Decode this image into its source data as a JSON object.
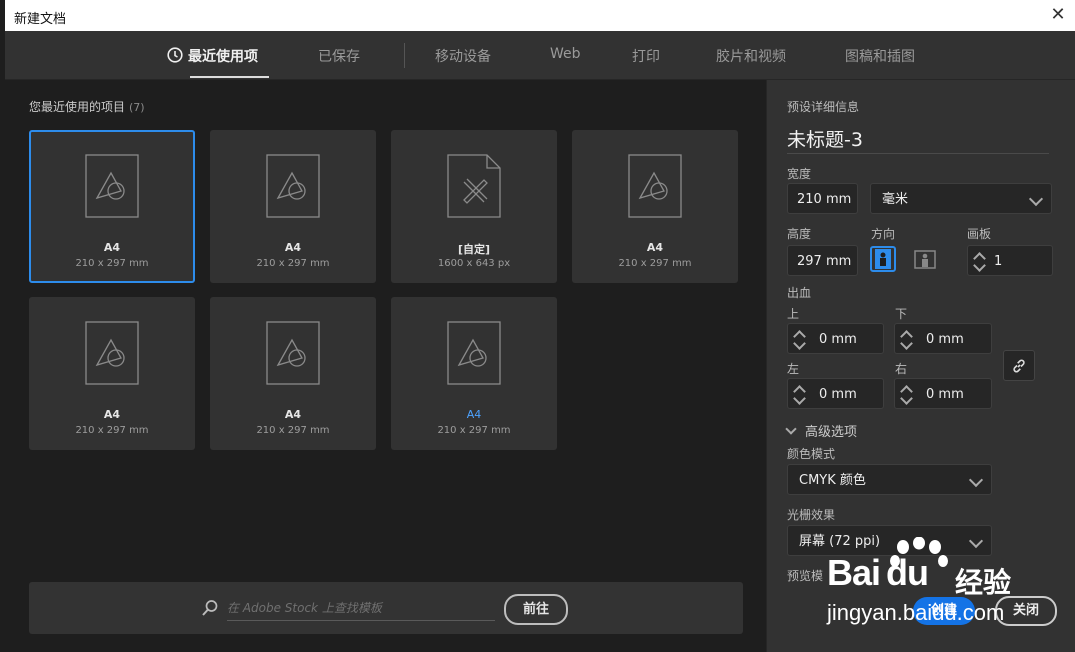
{
  "window": {
    "title": "新建文档",
    "close_icon": "close-icon"
  },
  "tabs": [
    {
      "label": "最近使用项",
      "active": true
    },
    {
      "label": "已保存"
    },
    {
      "label": "移动设备"
    },
    {
      "label": "Web"
    },
    {
      "label": "打印"
    },
    {
      "label": "胶片和视频"
    },
    {
      "label": "图稿和插图"
    }
  ],
  "recent": {
    "label": "您最近使用的项目",
    "count": "(7)",
    "items": [
      {
        "name": "A4",
        "dims": "210 x 297 mm",
        "selected": true,
        "icon": "document-shapes-icon"
      },
      {
        "name": "A4",
        "dims": "210 x 297 mm",
        "icon": "document-shapes-icon"
      },
      {
        "name": "[自定]",
        "dims": "1600 x 643 px",
        "icon": "document-tools-icon"
      },
      {
        "name": "A4",
        "dims": "210 x 297 mm",
        "icon": "document-shapes-icon"
      },
      {
        "name": "A4",
        "dims": "210 x 297 mm",
        "icon": "document-shapes-icon"
      },
      {
        "name": "A4",
        "dims": "210 x 297 mm",
        "icon": "document-shapes-icon"
      },
      {
        "name": "A4",
        "dims": "210 x 297 mm",
        "icon": "document-shapes-icon",
        "highlight": true
      }
    ]
  },
  "search": {
    "placeholder": "在 Adobe Stock 上查找模板",
    "go_label": "前往"
  },
  "preset": {
    "section_label": "预设详细信息",
    "doc_name": "未标题-3",
    "width_label": "宽度",
    "width_value": "210 mm",
    "unit_value": "毫米",
    "height_label": "高度",
    "height_value": "297 mm",
    "orientation_label": "方向",
    "artboards_label": "画板",
    "artboards_value": "1",
    "bleed_label": "出血",
    "bleed_top_label": "上",
    "bleed_top": "0 mm",
    "bleed_bottom_label": "下",
    "bleed_bottom": "0 mm",
    "bleed_left_label": "左",
    "bleed_left": "0 mm",
    "bleed_right_label": "右",
    "bleed_right": "0 mm",
    "advanced_label": "高级选项",
    "color_mode_label": "颜色模式",
    "color_mode_value": "CMYK 颜色",
    "raster_label": "光栅效果",
    "raster_value": "屏幕 (72 ppi)",
    "preview_label": "预览模",
    "create_label": "创建",
    "close_label": "关闭"
  },
  "colors": {
    "accent": "#1473e6",
    "selection": "#2d8ceb"
  },
  "watermark": {
    "brand_a": "Bai",
    "brand_b": "du",
    "brand_cn": "经验",
    "url": "jingyan.baidu.com"
  }
}
